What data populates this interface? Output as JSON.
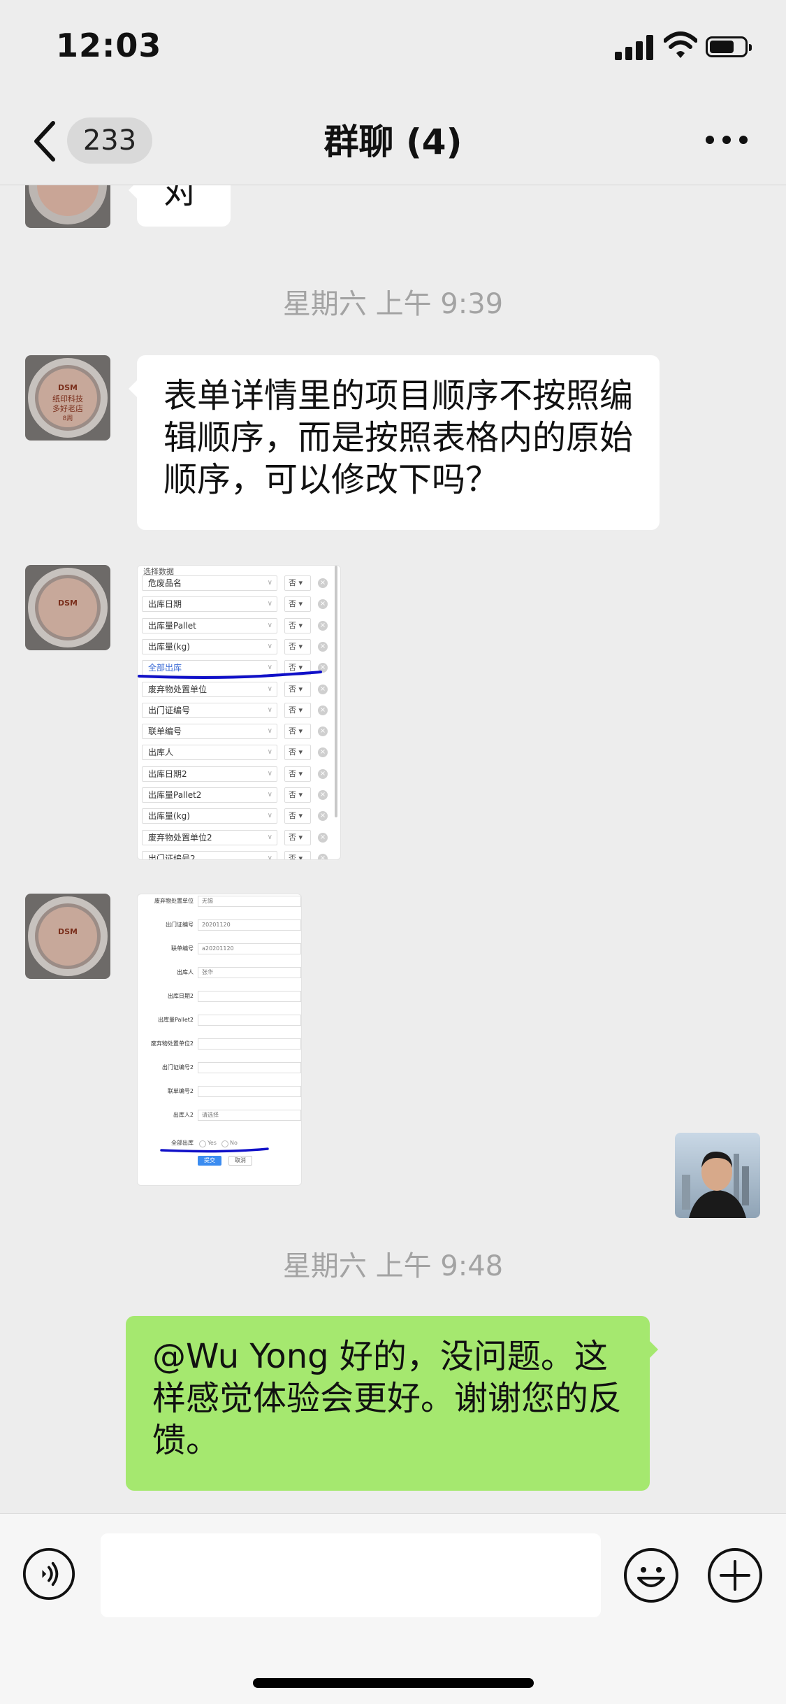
{
  "status_bar": {
    "time": "12:03"
  },
  "nav": {
    "unread_count": "233",
    "title": "群聊 (4)"
  },
  "messages": {
    "partial_text": "对",
    "timestamp_1": "星期六 上午 9:39",
    "text_1": "表单详情里的项目顺序不按照编辑顺序，而是按照表格内的原始顺序，可以修改下吗？",
    "timestamp_2": "星期六 上午 9:48",
    "reply": "@Wu Yong 好的，没问题。这样感觉体验会更好。谢谢您的反馈。"
  },
  "avatar_text": {
    "brand": "DSM",
    "line1": "纸印科技",
    "line2": "多好老店",
    "line3": "8周"
  },
  "select_screenshot": {
    "title": "选择数据",
    "option": "否",
    "fields": [
      "危废品名",
      "出库日期",
      "出库量Pallet",
      "出库量(kg)",
      "全部出库",
      "废弃物处置单位",
      "出门证编号",
      "联单编号",
      "出库人",
      "出库日期2",
      "出库量Pallet2",
      "出库量(kg)",
      "废弃物处置单位2"
    ],
    "partial_last": "出门证编号2"
  },
  "form_screenshot": {
    "rows": [
      {
        "label": "废弃物处置单位",
        "value": "无锡"
      },
      {
        "label": "出门证编号",
        "value": "20201120"
      },
      {
        "label": "联单编号",
        "value": "a20201120"
      },
      {
        "label": "出库人",
        "value": "张华"
      },
      {
        "label": "出库日期2",
        "value": ""
      },
      {
        "label": "出库量Pallet2",
        "value": ""
      },
      {
        "label": "废弃物处置单位2",
        "value": ""
      },
      {
        "label": "出门证编号2",
        "value": ""
      },
      {
        "label": "联单编号2",
        "value": ""
      },
      {
        "label": "出库人2",
        "value": "请选择"
      }
    ],
    "radio_label": "全部出库",
    "radio_yes": "Yes",
    "radio_no": "No",
    "submit": "提交",
    "cancel": "取消"
  },
  "colors": {
    "background": "#ededed",
    "incoming_bubble": "#ffffff",
    "outgoing_bubble": "#a5e86f",
    "annotation": "#1010c8"
  },
  "icons": [
    "back-chevron-icon",
    "more-icon",
    "voice-icon",
    "emoji-icon",
    "plus-icon"
  ]
}
